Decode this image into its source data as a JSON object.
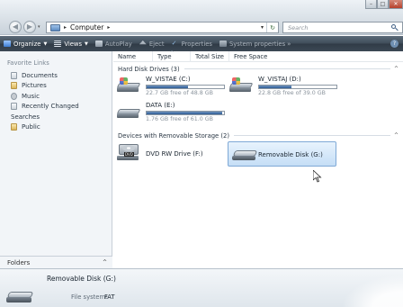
{
  "window": {
    "minimize_glyph": "–",
    "maximize_glyph": "□",
    "close_glyph": "✕"
  },
  "navigation": {
    "back_glyph": "◀",
    "forward_glyph": "▶",
    "address_sep": "▸",
    "address_text": "Computer",
    "address_trailing_sep": "▸",
    "search_placeholder": "Search"
  },
  "toolbar": {
    "organize": "Organize",
    "views": "Views",
    "autoplay": "AutoPlay",
    "eject": "Eject",
    "properties": "Properties",
    "system_properties": "System properties",
    "more": "»",
    "help": "?"
  },
  "nav_pane": {
    "heading": "Favorite Links",
    "items": [
      {
        "label": "Documents",
        "icon": "documents-icon"
      },
      {
        "label": "Pictures",
        "icon": "pictures-icon"
      },
      {
        "label": "Music",
        "icon": "music-icon"
      },
      {
        "label": "Recently Changed",
        "icon": "recently-changed-icon"
      },
      {
        "label": "Searches",
        "icon": "searches-icon"
      },
      {
        "label": "Public",
        "icon": "public-icon"
      }
    ],
    "folders_label": "Folders"
  },
  "columns": {
    "name": "Name",
    "type": "Type",
    "total_size": "Total Size",
    "free_space": "Free Space"
  },
  "groups": {
    "hard_disks": "Hard Disk Drives (3)",
    "removable": "Devices with Removable Storage (2)"
  },
  "drives": [
    {
      "name": "W_VISTAE (C:)",
      "free_text": "22.7 GB free of 48.8 GB",
      "used_fraction": 0.535
    },
    {
      "name": "W_VISTAJ (D:)",
      "free_text": "22.8 GB free of 39.0 GB",
      "used_fraction": 0.415
    },
    {
      "name": "DATA (E:)",
      "free_text": "1.76 GB free of 61.0 GB",
      "used_fraction": 0.971
    }
  ],
  "removable": [
    {
      "name": "DVD RW Drive (F:)",
      "badge": "DVD"
    },
    {
      "name": "Removable Disk (G:)"
    }
  ],
  "details": {
    "title": "Removable Disk (G:)",
    "file_system_label": "File system:",
    "file_system_value": "FAT"
  },
  "colors": {
    "toolbar": "#3c4855",
    "drive_fill": "#2d5b94",
    "selection": "#c5def6"
  }
}
